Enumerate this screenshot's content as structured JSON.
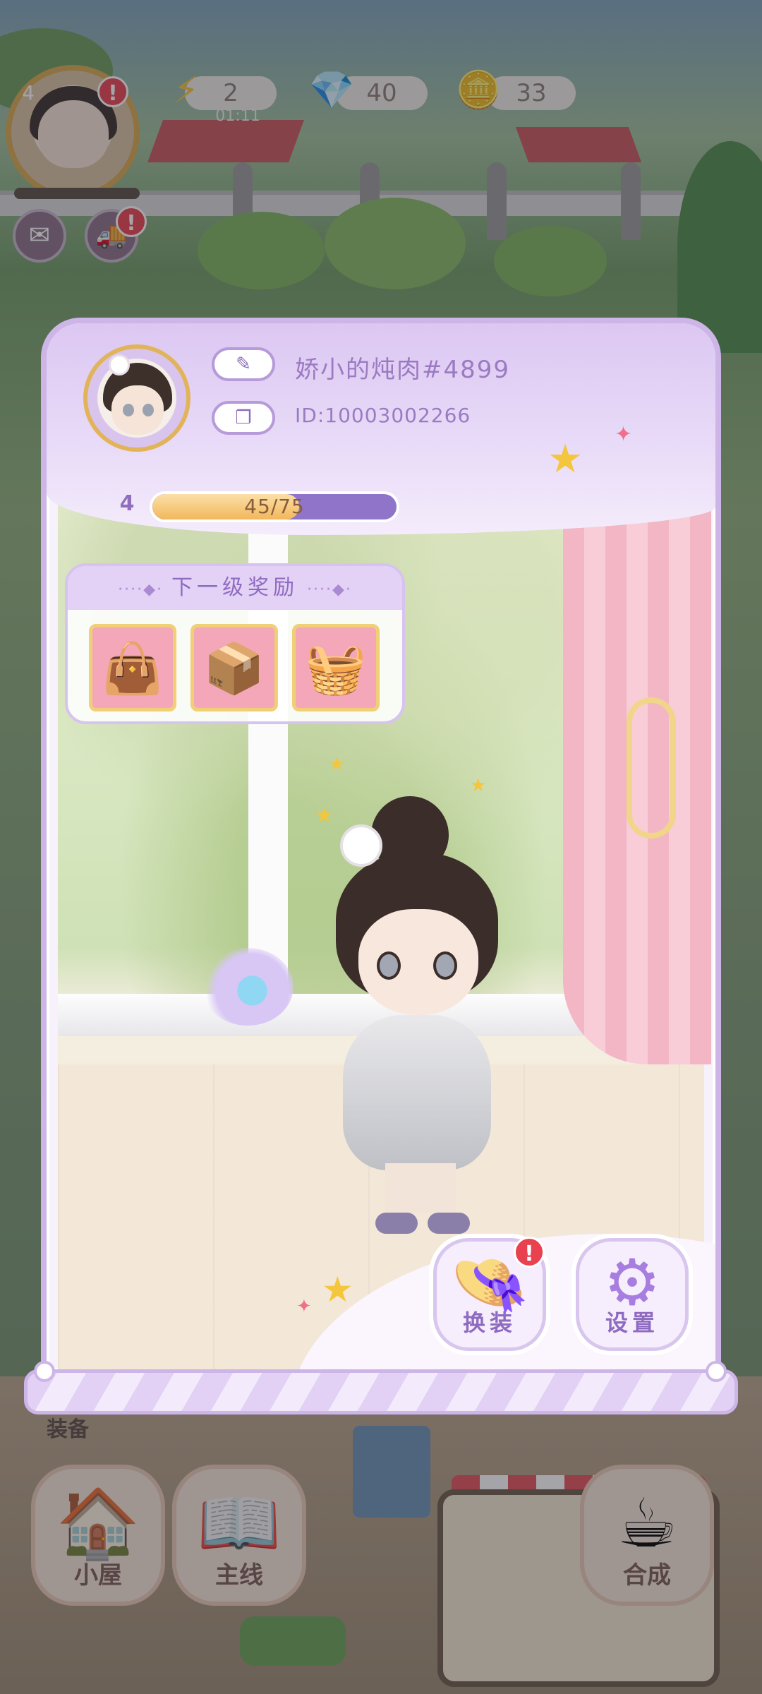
{
  "hud": {
    "player_level": "4",
    "energy": "2",
    "energy_timer": "01:11",
    "gems": "40",
    "coins": "33",
    "alert_mark": "!"
  },
  "profile": {
    "name": "娇小的炖肉#4899",
    "id": "ID:10003002266",
    "level": "4",
    "xp_text": "45/75",
    "xp_progress": 0.6
  },
  "rewards": {
    "title": "下一级奖励",
    "items": [
      {
        "icon": "bag-icon",
        "glyph": "👜"
      },
      {
        "icon": "cardboard-box-icon",
        "glyph": "📦"
      },
      {
        "icon": "food-basket-icon",
        "glyph": "🧺"
      }
    ]
  },
  "actions": {
    "dress_up": {
      "label": "换装",
      "icon": "hat-icon",
      "glyph": "👒"
    },
    "settings": {
      "label": "设置",
      "icon": "gear-icon",
      "glyph": "⚙"
    }
  },
  "bottom_nav": {
    "behind_label": "装备",
    "items": [
      {
        "label": "小屋",
        "icon": "house-icon",
        "glyph": "🏠"
      },
      {
        "label": "主线",
        "icon": "book-icon",
        "glyph": "📖"
      },
      {
        "label": "合成",
        "icon": "teacup-icon",
        "glyph": "☕"
      }
    ]
  },
  "colors": {
    "panel_border": "#cdb5e8",
    "accent_purple": "#9a7bc2",
    "xp_fill": "#f2b75c",
    "alert_red": "#e9414f"
  }
}
